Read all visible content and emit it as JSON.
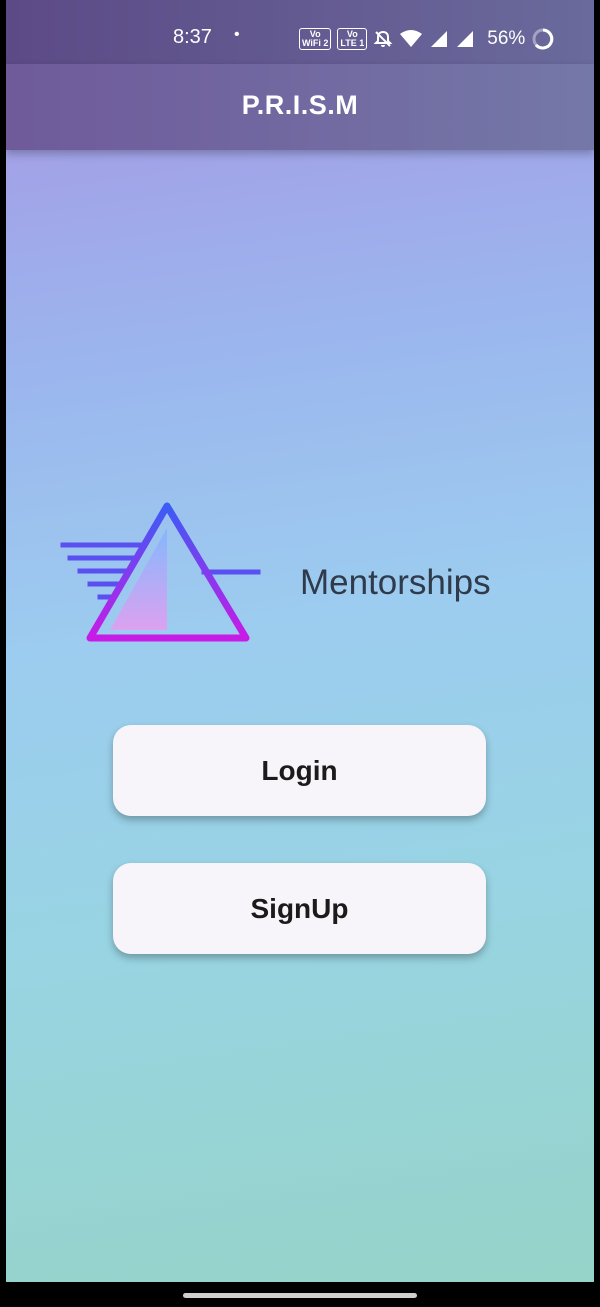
{
  "status_bar": {
    "time": "8:37",
    "dot": "•",
    "wifi_tag_top": "Vo",
    "wifi_tag_bottom": "WiFi 2",
    "lte_tag_top": "Vo",
    "lte_tag_bottom": "LTE 1",
    "battery": "56%"
  },
  "app_bar": {
    "title": "P.R.I.S.M"
  },
  "brand": {
    "name": "Mentorships"
  },
  "actions": {
    "login": "Login",
    "signup": "SignUp"
  },
  "colors": {
    "text_dark": "#2f3a4a",
    "button_bg": "#f7f5f9",
    "logo_blue": "#4a5cf2",
    "logo_magenta": "#c61be8"
  }
}
